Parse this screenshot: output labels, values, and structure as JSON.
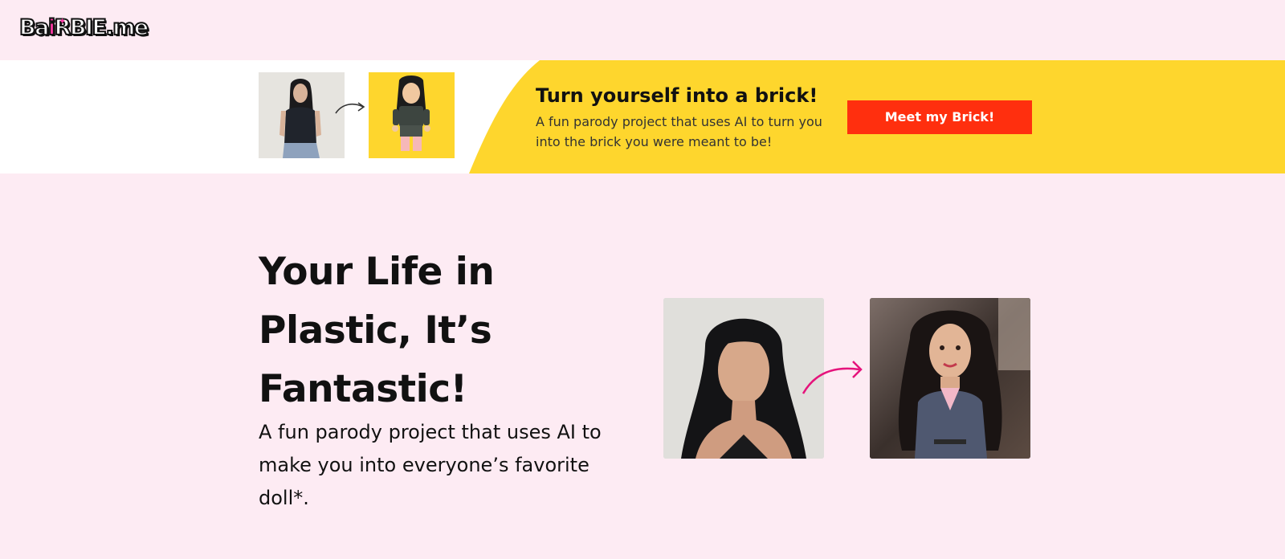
{
  "header": {
    "logo": {
      "part1": "Ba",
      "part2": "i",
      "part3": "RBIE.me",
      "icon": "sparkle-icon"
    }
  },
  "banner": {
    "title": "Turn yourself into a brick!",
    "description": "A fun parody project that uses AI to turn you into the brick you were meant to be!",
    "button_label": "Meet my Brick!",
    "colors": {
      "background": "#fed62d",
      "button": "#ff2f0e"
    },
    "images": [
      "photo-woman-icon",
      "brick-figure-icon"
    ],
    "arrow_icon": "curved-arrow-icon"
  },
  "hero": {
    "title": "Your Life in Plastic, It’s Fantastic!",
    "description": "A fun parody project that uses AI to make you into everyone’s favorite doll*.",
    "images": [
      "portrait-photo-icon",
      "doll-portrait-icon"
    ],
    "arrow_icon": "pink-curved-arrow-icon",
    "colors": {
      "background": "#fdebf3",
      "arrow": "#e5137b"
    }
  }
}
